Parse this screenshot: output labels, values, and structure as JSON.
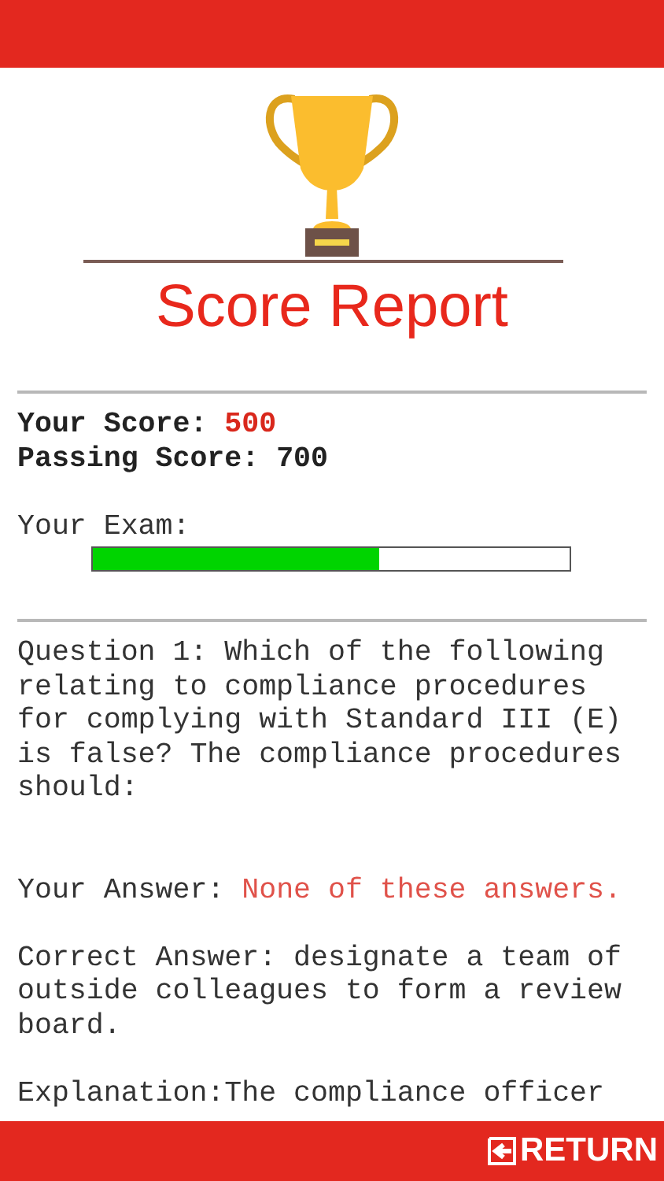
{
  "title": "Score Report",
  "scores": [
    {
      "label": "Your Score:",
      "value": "500",
      "highlight": true
    },
    {
      "label": "Passing Score:",
      "value": "700",
      "highlight": false
    }
  ],
  "exam": {
    "label": "Your Exam:",
    "level": 0.6
  },
  "question": "Question 1: Which of the following relating to compliance procedures for complying with Standard III (E) is false? The compliance procedures should:",
  "your_answer": {
    "label": "Your Answer:",
    "value": "None of these answers."
  },
  "correct_answer": "Correct Answer: designate a team of outside colleagues to form a review board.",
  "explanation": "Explanation:The compliance officer",
  "footer": {
    "button": "RETURN"
  }
}
